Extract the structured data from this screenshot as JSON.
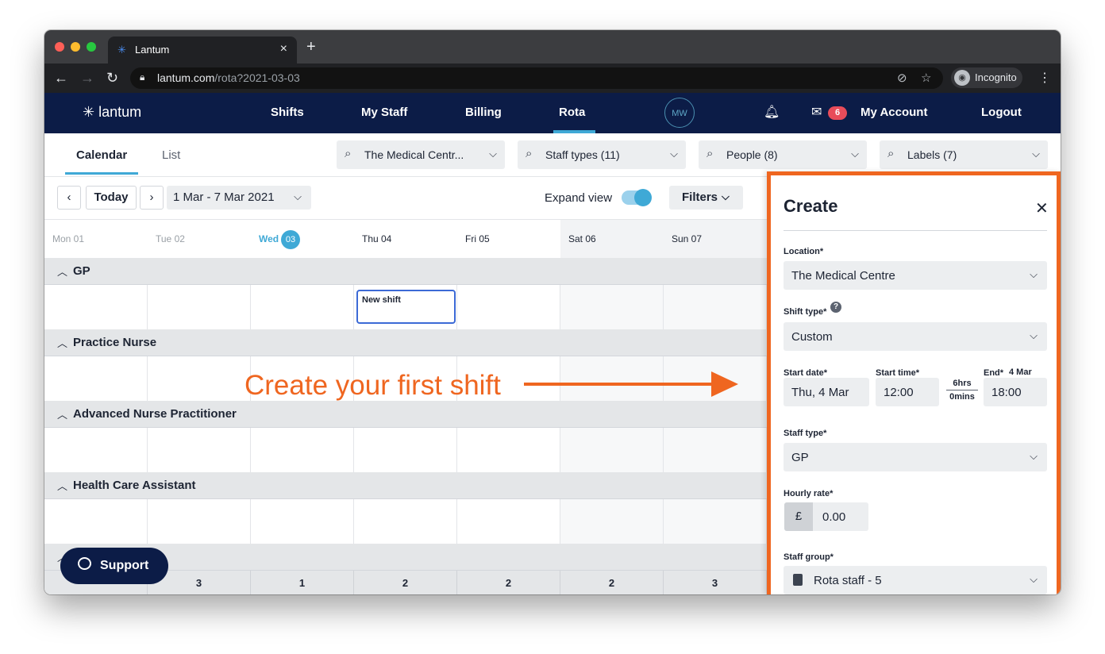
{
  "browser": {
    "tab_title": "Lantum",
    "url_host": "lantum.com",
    "url_path": "/rota?2021-03-03",
    "incognito_label": "Incognito"
  },
  "app": {
    "logo": "lantum",
    "nav": [
      "Shifts",
      "My Staff",
      "Billing",
      "Rota"
    ],
    "active_nav": "Rota",
    "avatar": "MW",
    "message_count": "6",
    "my_account": "My Account",
    "logout": "Logout"
  },
  "subheader": {
    "tabs": [
      "Calendar",
      "List"
    ],
    "active_tab": "Calendar",
    "filters": [
      "The Medical Centr...",
      "Staff types (11)",
      "People (8)",
      "Labels (7)"
    ]
  },
  "toolbar": {
    "prev": "‹",
    "today": "Today",
    "next": "›",
    "date_range": "1 Mar - 7 Mar 2021",
    "expand_label": "Expand view",
    "expand_on": true,
    "filters_label": "Filters"
  },
  "days": [
    {
      "label": "Mon 01",
      "past": true
    },
    {
      "label": "Tue 02",
      "past": true
    },
    {
      "label": "Wed",
      "num": "03",
      "today": true
    },
    {
      "label": "Thu 04"
    },
    {
      "label": "Fri 05"
    },
    {
      "label": "Sat 06",
      "weekend": true
    },
    {
      "label": "Sun 07",
      "weekend": true
    }
  ],
  "sections": [
    "GP",
    "Practice Nurse",
    "Advanced Nurse Practitioner",
    "Health Care Assistant"
  ],
  "new_shift_label": "New shift",
  "callout": "Create your first shift",
  "totals": [
    "",
    "3",
    "1",
    "2",
    "2",
    "2",
    "3"
  ],
  "support_label": "Support",
  "create_panel": {
    "title": "Create",
    "location_label": "Location*",
    "location_value": "The Medical Centre",
    "shift_type_label": "Shift type*",
    "shift_type_help": "?",
    "shift_type_value": "Custom",
    "start_date_label": "Start date*",
    "start_date_value": "Thu, 4 Mar",
    "start_time_label": "Start time*",
    "start_time_value": "12:00",
    "duration_hours": "6hrs",
    "duration_mins": "0mins",
    "end_label": "End*",
    "end_date_hint": "4 Mar",
    "end_time_value": "18:00",
    "staff_type_label": "Staff type*",
    "staff_type_value": "GP",
    "hourly_rate_label": "Hourly rate*",
    "currency": "£",
    "hourly_rate_value": "0.00",
    "staff_group_label": "Staff group*",
    "staff_group_value": "Rota staff - 5"
  },
  "colors": {
    "nav_bg": "#0c1c47",
    "accent": "#3fa9d6",
    "callout_orange": "#ef6620",
    "badge_red": "#e84c5a"
  },
  "icons": [
    "back-arrow-icon",
    "forward-arrow-icon",
    "reload-icon",
    "lock-icon",
    "eye-off-icon",
    "star-icon",
    "incognito-icon",
    "kebab-icon",
    "bell-icon",
    "mail-icon",
    "search-icon",
    "chevron-down-icon",
    "chevron-up-icon",
    "help-icon",
    "close-icon",
    "chat-bubble-icon",
    "clipboard-icon"
  ]
}
